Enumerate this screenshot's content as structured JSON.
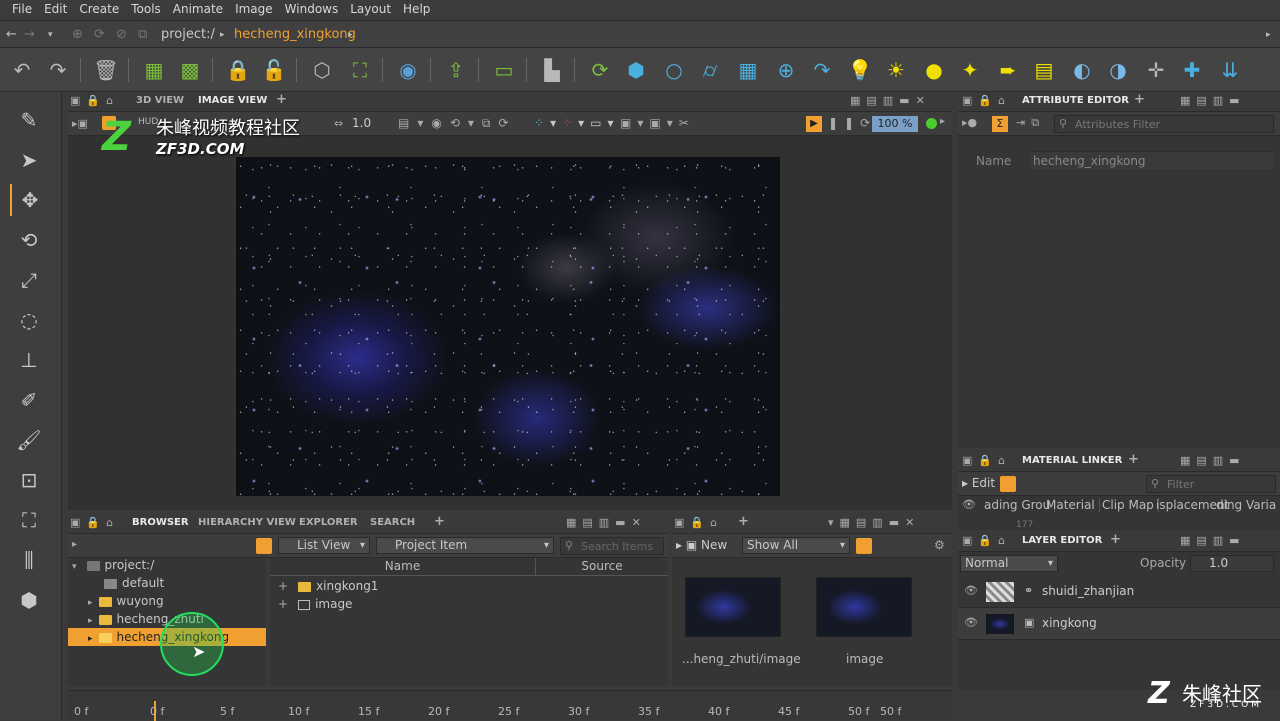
{
  "menu": [
    "File",
    "Edit",
    "Create",
    "Tools",
    "Animate",
    "Image",
    "Windows",
    "Layout",
    "Help"
  ],
  "path": {
    "root": "project:/",
    "current": "hecheng_xingkong"
  },
  "viewer": {
    "tabs": [
      "3D VIEW",
      "IMAGE VIEW"
    ],
    "hud": "HUD",
    "exposure": "1.0",
    "zoom": "100 %"
  },
  "watermark": {
    "cn": "朱峰视频教程社区",
    "en": "ZF3D.COM",
    "corner_cn": "朱峰社区",
    "corner_en": "ZF3D.COM"
  },
  "attribute_editor": {
    "title": "ATTRIBUTE EDITOR",
    "filter_placeholder": "Attributes Filter",
    "name_label": "Name",
    "name_value": "hecheng_xingkong"
  },
  "material_linker": {
    "title": "MATERIAL LINKER",
    "edit": "Edit",
    "filter_placeholder": "Filter",
    "columns": [
      "ading Grou",
      "Material",
      "Clip Map",
      "isplacement",
      "ding Varia"
    ],
    "row_value": "177"
  },
  "layer_editor": {
    "title": "LAYER EDITOR",
    "blend": "Normal",
    "opacity_label": "Opacity",
    "opacity": "1.0",
    "layers": [
      "shuidi_zhanjian",
      "xingkong"
    ]
  },
  "browser": {
    "tabs": [
      "BROWSER",
      "HIERARCHY VIEW",
      "EXPLORER",
      "SEARCH"
    ],
    "view_mode": "List View",
    "filter": "Project Item",
    "search_placeholder": "Search Items",
    "tree": [
      "project:/",
      "default",
      "wuyong",
      "hecheng_zhuti",
      "hecheng_xingkong"
    ],
    "columns": [
      "Name",
      "Source"
    ],
    "items": [
      "xingkong1",
      "image"
    ]
  },
  "preview": {
    "new": "New",
    "show": "Show All",
    "thumbs": [
      "...heng_zhuti/image",
      "image"
    ]
  },
  "timeline": {
    "ticks": [
      "0 f",
      "0 f",
      "5 f",
      "10 f",
      "15 f",
      "20 f",
      "25 f",
      "30 f",
      "35 f",
      "40 f",
      "45 f",
      "50 f"
    ],
    "end": "50 f"
  }
}
